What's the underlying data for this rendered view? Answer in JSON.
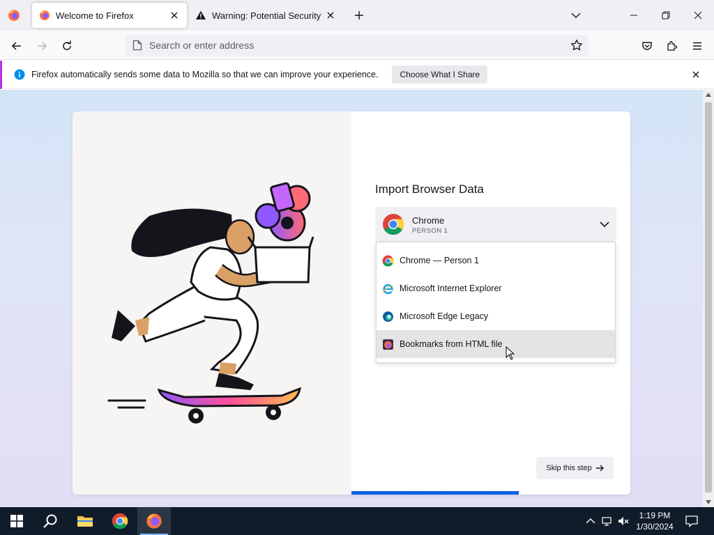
{
  "tabs": [
    {
      "title": "Welcome to Firefox",
      "active": true
    },
    {
      "title": "Warning: Potential Security Risk Ahead",
      "active": false
    }
  ],
  "urlbar": {
    "placeholder": "Search or enter address"
  },
  "notification": {
    "message": "Firefox automatically sends some data to Mozilla so that we can improve your experience.",
    "button": "Choose What I Share"
  },
  "import": {
    "title": "Import Browser Data",
    "selected": {
      "name": "Chrome",
      "profile": "PERSON 1"
    },
    "options": [
      {
        "label": "Chrome — Person 1",
        "icon": "chrome-icon"
      },
      {
        "label": "Microsoft Internet Explorer",
        "icon": "internet-explorer-icon"
      },
      {
        "label": "Microsoft Edge Legacy",
        "icon": "edge-legacy-icon"
      },
      {
        "label": "Bookmarks from HTML file",
        "icon": "firefox-bookmarks-icon",
        "hovered": true
      }
    ],
    "skip": "Skip this step",
    "progress": 0.6
  },
  "taskbar": {
    "time": "1:19 PM",
    "date": "1/30/2024"
  },
  "colors": {
    "accent": "#0061e0",
    "notification_bar": "#b833e1",
    "taskbar": "#101c2a"
  }
}
